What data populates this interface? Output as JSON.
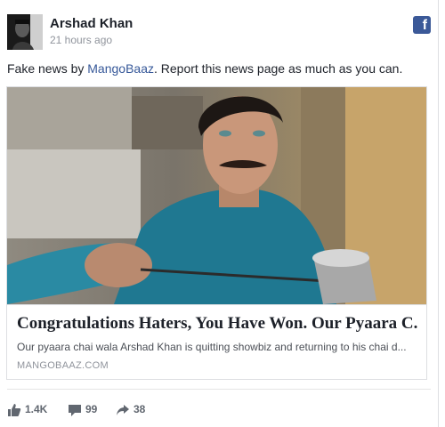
{
  "post": {
    "author": "Arshad Khan",
    "time": "21 hours ago",
    "platform_icon": "facebook-icon",
    "status_prefix": "Fake news by ",
    "status_link": "MangoBaaz",
    "status_suffix": ". Report this news page as much as you can."
  },
  "link_card": {
    "title": "Congratulations Haters, You Have Won. Our Pyaara C...",
    "description": "Our pyaara chai wala Arshad Khan is quitting showbiz and returning to his chai d...",
    "domain": "MANGOBAAZ.COM"
  },
  "stats": {
    "likes": "1.4K",
    "comments": "99",
    "shares": "38"
  },
  "colors": {
    "link": "#365899",
    "facebook": "#3b5998",
    "muted": "#90949c"
  }
}
